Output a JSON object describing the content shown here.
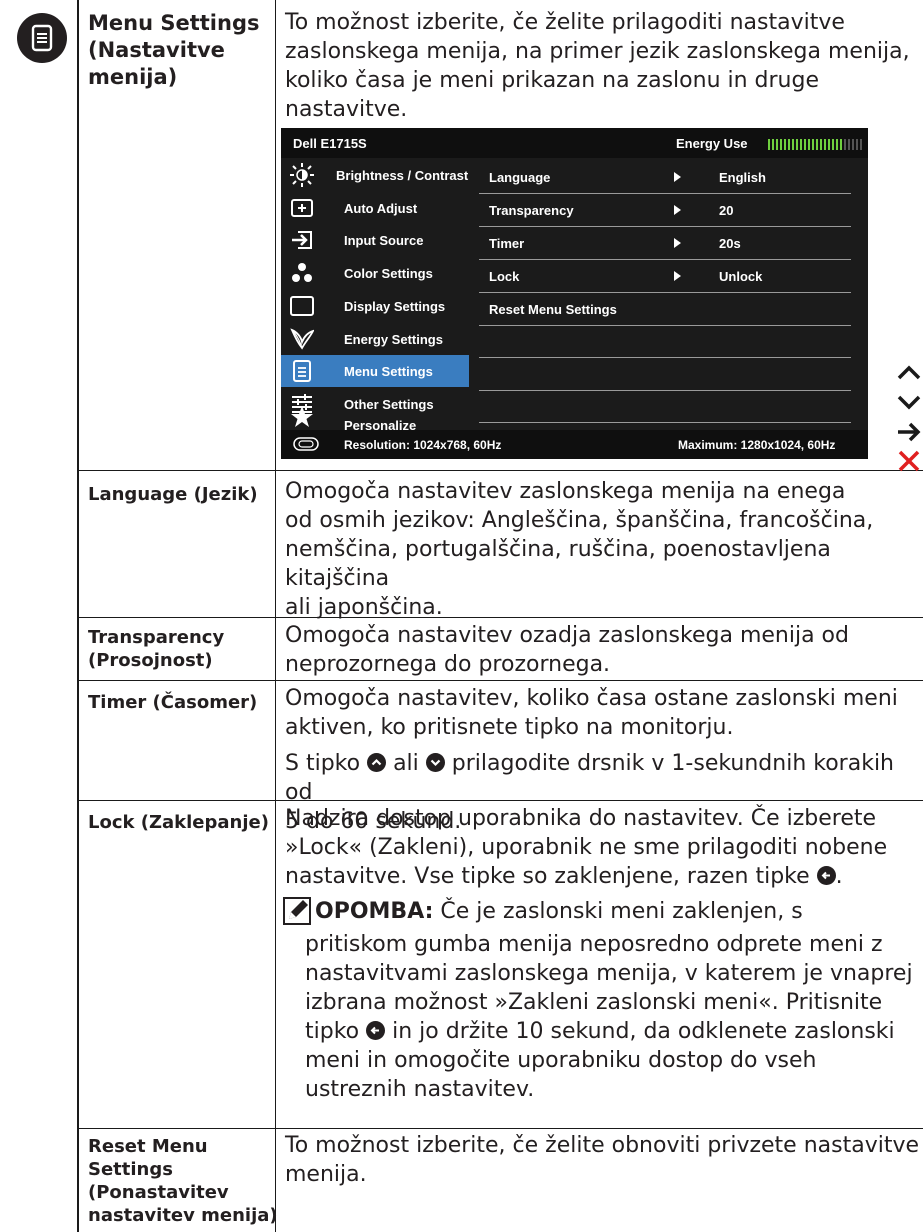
{
  "menu_settings": {
    "title_lines": [
      "Menu Settings",
      "(Nastavitve",
      "menija)"
    ],
    "desc_lines": [
      "To možnost izberite, če želite prilagoditi nastavitve",
      "zaslonskega menija, na primer jezik zaslonskega menija,",
      "koliko časa je meni prikazan na zaslonu in druge",
      "nastavitve."
    ]
  },
  "osd": {
    "model": "Dell E1715S",
    "energy_label": "Energy Use",
    "left_items": [
      {
        "label": "Brightness / Contrast",
        "icon": "brightness-icon"
      },
      {
        "label": "Auto Adjust",
        "icon": "auto-adjust-icon"
      },
      {
        "label": "Input Source",
        "icon": "input-source-icon"
      },
      {
        "label": "Color Settings",
        "icon": "color-settings-icon"
      },
      {
        "label": "Display Settings",
        "icon": "display-settings-icon"
      },
      {
        "label": "Energy Settings",
        "icon": "energy-settings-icon"
      },
      {
        "label": "Menu Settings",
        "icon": "menu-settings-icon",
        "selected": true
      },
      {
        "label": "Other Settings",
        "icon": "other-settings-icon"
      },
      {
        "label": "Personalize",
        "icon": "star-icon"
      }
    ],
    "rows": [
      {
        "key": "Language",
        "value": "English"
      },
      {
        "key": "Transparency",
        "value": "20"
      },
      {
        "key": "Timer",
        "value": "20s"
      },
      {
        "key": "Lock",
        "value": "Unlock"
      },
      {
        "key": "Reset Menu Settings",
        "value": ""
      }
    ],
    "resolution": "Resolution: 1024x768, 60Hz",
    "maximum": "Maximum: 1280x1024, 60Hz",
    "side_buttons": [
      "up-icon",
      "down-icon",
      "enter-icon",
      "exit-icon"
    ],
    "colors": {
      "selected": "#3a7dc0",
      "energy_on": "#6fcf3f",
      "exit": "#e02020"
    }
  },
  "language": {
    "label": "Language (Jezik)",
    "desc_lines": [
      "Omogoča nastavitev zaslonskega menija na enega",
      "od osmih jezikov: Angleščina, španščina, francoščina,",
      "nemščina, portugalščina, ruščina, poenostavljena kitajščina",
      "ali japonščina."
    ]
  },
  "transparency": {
    "label_lines": [
      "Transparency",
      "(Prosojnost)"
    ],
    "desc_lines": [
      "Omogoča nastavitev ozadja zaslonskega menija od",
      "neprozornega do prozornega."
    ]
  },
  "timer": {
    "label": "Timer (Časomer)",
    "desc_lines": [
      "Omogoča nastavitev, koliko časa ostane zaslonski meni",
      "aktiven, ko pritisnete tipko na monitorju."
    ],
    "slider_line1_a": "S tipko ",
    "slider_line1_b": " ali ",
    "slider_line1_c": " prilagodite drsnik v 1-sekundnih korakih od",
    "slider_line2": "5 do 60 sekund."
  },
  "lock": {
    "label": "Lock (Zaklepanje)",
    "desc_lines": [
      "Nadzira dostop uporabnika do nastavitev. Če izberete",
      "»Lock« (Zakleni), uporabnik ne sme prilagoditi nobene"
    ],
    "desc_line3": "nastavitve. Vse tipke so zaklenjene, razen tipke ",
    "desc_line3_end": ".",
    "note_label": "OPOMBA:",
    "note_line1": " Če je zaslonski meni zaklenjen, s",
    "note_lines": [
      "pritiskom gumba menija neposredno odprete meni z",
      "nastavitvami zaslonskega menija, v katerem je vnaprej",
      "izbrana možnost »Zakleni zaslonski meni«. Pritisnite"
    ],
    "note_line5a": "tipko ",
    "note_line5b": " in jo držite 10 sekund, da odklenete zaslonski",
    "note_lines_end": [
      "meni in omogočite uporabniku dostop do vseh",
      "ustreznih nastavitev."
    ]
  },
  "reset": {
    "label_lines": [
      "Reset Menu",
      "Settings",
      "(Ponastavitev",
      "nastavitev menija)"
    ],
    "desc_lines": [
      "To možnost izberite, če želite obnoviti privzete nastavitve",
      "menija."
    ]
  }
}
